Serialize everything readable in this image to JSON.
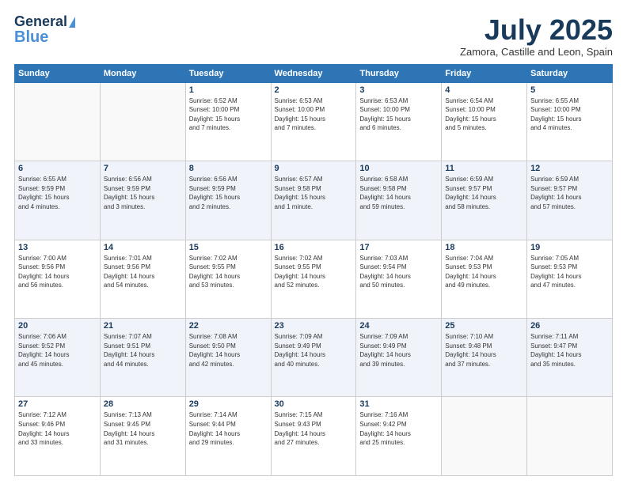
{
  "logo": {
    "line1": "General",
    "line2": "Blue"
  },
  "title": "July 2025",
  "subtitle": "Zamora, Castille and Leon, Spain",
  "weekdays": [
    "Sunday",
    "Monday",
    "Tuesday",
    "Wednesday",
    "Thursday",
    "Friday",
    "Saturday"
  ],
  "weeks": [
    [
      {
        "day": "",
        "info": ""
      },
      {
        "day": "",
        "info": ""
      },
      {
        "day": "1",
        "info": "Sunrise: 6:52 AM\nSunset: 10:00 PM\nDaylight: 15 hours\nand 7 minutes."
      },
      {
        "day": "2",
        "info": "Sunrise: 6:53 AM\nSunset: 10:00 PM\nDaylight: 15 hours\nand 7 minutes."
      },
      {
        "day": "3",
        "info": "Sunrise: 6:53 AM\nSunset: 10:00 PM\nDaylight: 15 hours\nand 6 minutes."
      },
      {
        "day": "4",
        "info": "Sunrise: 6:54 AM\nSunset: 10:00 PM\nDaylight: 15 hours\nand 5 minutes."
      },
      {
        "day": "5",
        "info": "Sunrise: 6:55 AM\nSunset: 10:00 PM\nDaylight: 15 hours\nand 4 minutes."
      }
    ],
    [
      {
        "day": "6",
        "info": "Sunrise: 6:55 AM\nSunset: 9:59 PM\nDaylight: 15 hours\nand 4 minutes."
      },
      {
        "day": "7",
        "info": "Sunrise: 6:56 AM\nSunset: 9:59 PM\nDaylight: 15 hours\nand 3 minutes."
      },
      {
        "day": "8",
        "info": "Sunrise: 6:56 AM\nSunset: 9:59 PM\nDaylight: 15 hours\nand 2 minutes."
      },
      {
        "day": "9",
        "info": "Sunrise: 6:57 AM\nSunset: 9:58 PM\nDaylight: 15 hours\nand 1 minute."
      },
      {
        "day": "10",
        "info": "Sunrise: 6:58 AM\nSunset: 9:58 PM\nDaylight: 14 hours\nand 59 minutes."
      },
      {
        "day": "11",
        "info": "Sunrise: 6:59 AM\nSunset: 9:57 PM\nDaylight: 14 hours\nand 58 minutes."
      },
      {
        "day": "12",
        "info": "Sunrise: 6:59 AM\nSunset: 9:57 PM\nDaylight: 14 hours\nand 57 minutes."
      }
    ],
    [
      {
        "day": "13",
        "info": "Sunrise: 7:00 AM\nSunset: 9:56 PM\nDaylight: 14 hours\nand 56 minutes."
      },
      {
        "day": "14",
        "info": "Sunrise: 7:01 AM\nSunset: 9:56 PM\nDaylight: 14 hours\nand 54 minutes."
      },
      {
        "day": "15",
        "info": "Sunrise: 7:02 AM\nSunset: 9:55 PM\nDaylight: 14 hours\nand 53 minutes."
      },
      {
        "day": "16",
        "info": "Sunrise: 7:02 AM\nSunset: 9:55 PM\nDaylight: 14 hours\nand 52 minutes."
      },
      {
        "day": "17",
        "info": "Sunrise: 7:03 AM\nSunset: 9:54 PM\nDaylight: 14 hours\nand 50 minutes."
      },
      {
        "day": "18",
        "info": "Sunrise: 7:04 AM\nSunset: 9:53 PM\nDaylight: 14 hours\nand 49 minutes."
      },
      {
        "day": "19",
        "info": "Sunrise: 7:05 AM\nSunset: 9:53 PM\nDaylight: 14 hours\nand 47 minutes."
      }
    ],
    [
      {
        "day": "20",
        "info": "Sunrise: 7:06 AM\nSunset: 9:52 PM\nDaylight: 14 hours\nand 45 minutes."
      },
      {
        "day": "21",
        "info": "Sunrise: 7:07 AM\nSunset: 9:51 PM\nDaylight: 14 hours\nand 44 minutes."
      },
      {
        "day": "22",
        "info": "Sunrise: 7:08 AM\nSunset: 9:50 PM\nDaylight: 14 hours\nand 42 minutes."
      },
      {
        "day": "23",
        "info": "Sunrise: 7:09 AM\nSunset: 9:49 PM\nDaylight: 14 hours\nand 40 minutes."
      },
      {
        "day": "24",
        "info": "Sunrise: 7:09 AM\nSunset: 9:49 PM\nDaylight: 14 hours\nand 39 minutes."
      },
      {
        "day": "25",
        "info": "Sunrise: 7:10 AM\nSunset: 9:48 PM\nDaylight: 14 hours\nand 37 minutes."
      },
      {
        "day": "26",
        "info": "Sunrise: 7:11 AM\nSunset: 9:47 PM\nDaylight: 14 hours\nand 35 minutes."
      }
    ],
    [
      {
        "day": "27",
        "info": "Sunrise: 7:12 AM\nSunset: 9:46 PM\nDaylight: 14 hours\nand 33 minutes."
      },
      {
        "day": "28",
        "info": "Sunrise: 7:13 AM\nSunset: 9:45 PM\nDaylight: 14 hours\nand 31 minutes."
      },
      {
        "day": "29",
        "info": "Sunrise: 7:14 AM\nSunset: 9:44 PM\nDaylight: 14 hours\nand 29 minutes."
      },
      {
        "day": "30",
        "info": "Sunrise: 7:15 AM\nSunset: 9:43 PM\nDaylight: 14 hours\nand 27 minutes."
      },
      {
        "day": "31",
        "info": "Sunrise: 7:16 AM\nSunset: 9:42 PM\nDaylight: 14 hours\nand 25 minutes."
      },
      {
        "day": "",
        "info": ""
      },
      {
        "day": "",
        "info": ""
      }
    ]
  ]
}
